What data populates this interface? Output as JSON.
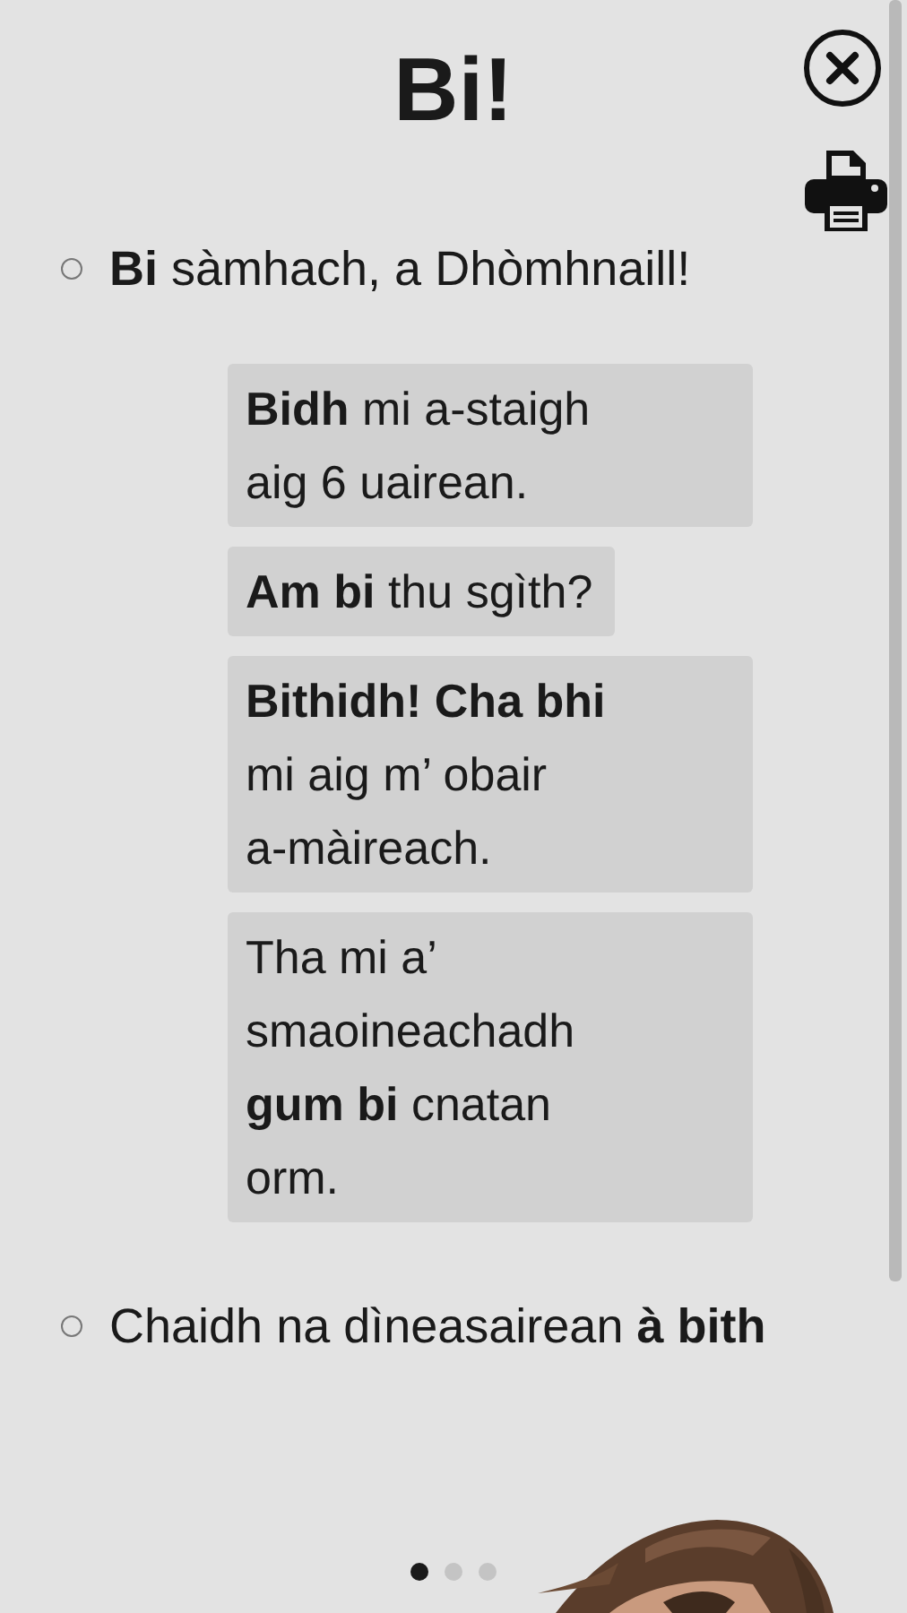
{
  "title": "Bi!",
  "items": [
    {
      "kind": "bullet",
      "text": "**Bi** sàmhach, a Dhòmhnaill!"
    },
    {
      "kind": "examples",
      "boxes": [
        {
          "lines": [
            "**Bidh** mi a-staigh",
            "aig 6 uairean."
          ]
        },
        {
          "lines": [
            "**Am bi** thu sgìth?"
          ]
        },
        {
          "lines": [
            "**Bithidh! Cha bhi**",
            "mi aig m’ obair",
            "a-màireach."
          ]
        },
        {
          "lines": [
            "Tha mi a’",
            "smaoineachadh",
            "**gum bi** cnatan",
            "orm."
          ]
        }
      ]
    },
    {
      "kind": "bullet",
      "text": "Chaidh na dìneasairean **à bith**"
    }
  ],
  "pages": [
    {
      "selected": true
    },
    {
      "selected": false
    },
    {
      "selected": false
    }
  ]
}
